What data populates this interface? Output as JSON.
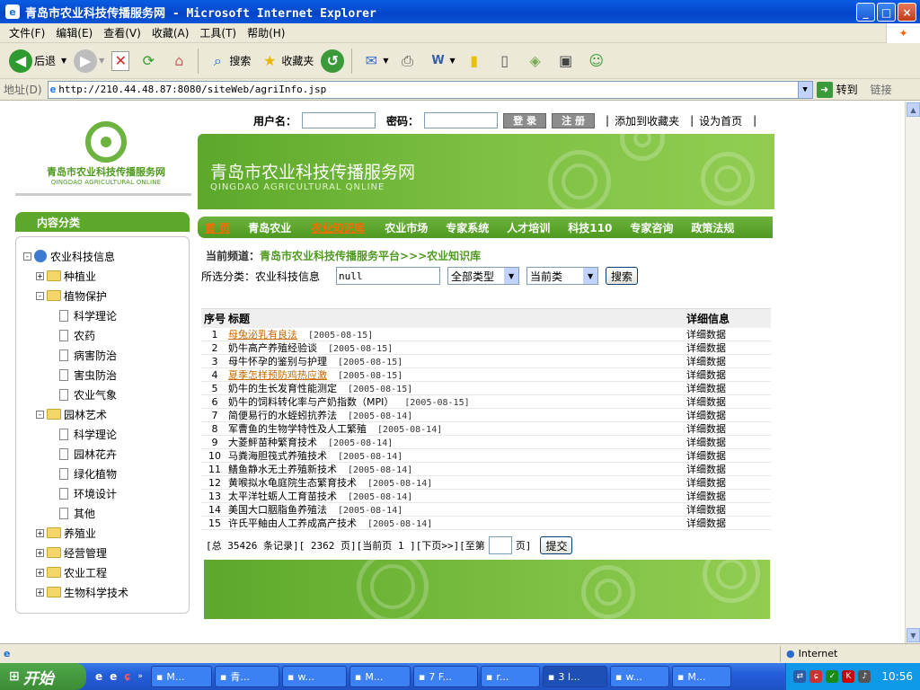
{
  "window": {
    "title": "青岛市农业科技传播服务网 - Microsoft Internet Explorer",
    "minimize_label": "_",
    "maximize_label": "□",
    "close_label": "×"
  },
  "menu": [
    "文件(F)",
    "编辑(E)",
    "查看(V)",
    "收藏(A)",
    "工具(T)",
    "帮助(H)"
  ],
  "toolbar": {
    "back": "后退",
    "search": "搜索",
    "favorites": "收藏夹"
  },
  "address": {
    "label": "地址(D)",
    "url": "http://210.44.48.87:8080/siteWeb/agriInfo.jsp",
    "go": "转到",
    "links": "链接"
  },
  "site": {
    "logo_cn": "青岛市农业科技传播服务网",
    "logo_en": "QINGDAO AGRICULTURAL ONLINE",
    "banner_title": "青岛市农业科技传播服务网",
    "banner_sub": "QINGDAO AGRICULTURAL QNLINE"
  },
  "login": {
    "user_label": "用户名：",
    "pwd_label": "密码：",
    "login_btn": "登 录",
    "register_btn": "注 册",
    "favorites_link": "添加到收藏夹",
    "homepage_link": "设为首页",
    "divider": "|"
  },
  "sidebar": {
    "title": "内容分类",
    "tree": [
      {
        "label": "农业科技信息",
        "level": 0,
        "type": "globe",
        "toggle": "-"
      },
      {
        "label": "种植业",
        "level": 1,
        "type": "folder",
        "toggle": "+"
      },
      {
        "label": "植物保护",
        "level": 1,
        "type": "folder",
        "toggle": "-"
      },
      {
        "label": "科学理论",
        "level": 2,
        "type": "doc"
      },
      {
        "label": "农药",
        "level": 2,
        "type": "doc"
      },
      {
        "label": "病害防治",
        "level": 2,
        "type": "doc"
      },
      {
        "label": "害虫防治",
        "level": 2,
        "type": "doc"
      },
      {
        "label": "农业气象",
        "level": 2,
        "type": "doc"
      },
      {
        "label": "园林艺术",
        "level": 1,
        "type": "folder",
        "toggle": "-"
      },
      {
        "label": "科学理论",
        "level": 2,
        "type": "doc"
      },
      {
        "label": "园林花卉",
        "level": 2,
        "type": "doc"
      },
      {
        "label": "绿化植物",
        "level": 2,
        "type": "doc"
      },
      {
        "label": "环境设计",
        "level": 2,
        "type": "doc"
      },
      {
        "label": "其他",
        "level": 2,
        "type": "doc"
      },
      {
        "label": "养殖业",
        "level": 1,
        "type": "folder",
        "toggle": "+"
      },
      {
        "label": "经营管理",
        "level": 1,
        "type": "folder",
        "toggle": "+"
      },
      {
        "label": "农业工程",
        "level": 1,
        "type": "folder",
        "toggle": "+"
      },
      {
        "label": "生物科学技术",
        "level": 1,
        "type": "folder",
        "toggle": "+"
      }
    ]
  },
  "nav": {
    "items": [
      "首 页",
      "青岛农业",
      "农业知识库",
      "农业市场",
      "专家系统",
      "人才培训",
      "科技110",
      "专家咨询",
      "政策法规"
    ],
    "active": [
      true,
      false,
      true,
      false,
      false,
      false,
      false,
      false,
      false
    ]
  },
  "breadcrumb": {
    "prefix": "当前频道：",
    "path": "青岛市农业科技传播服务平台>>>农业知识库"
  },
  "filter": {
    "label": "所选分类：农业科技信息",
    "query": "null",
    "type": "全部类型",
    "scope": "当前类",
    "search_btn": "搜索"
  },
  "table": {
    "headers": [
      "序号",
      "标题",
      "详细信息"
    ],
    "rows": [
      {
        "no": "1",
        "title": "母兔泌乳有良法",
        "date": "[2005-08-15]",
        "detail": "详细数据",
        "link": true
      },
      {
        "no": "2",
        "title": "奶牛高产养殖经验谈",
        "date": "[2005-08-15]",
        "detail": "详细数据",
        "link": false
      },
      {
        "no": "3",
        "title": "母牛怀孕的鉴别与护理",
        "date": "[2005-08-15]",
        "detail": "详细数据",
        "link": false
      },
      {
        "no": "4",
        "title": "夏季怎样预防鸡热应激",
        "date": "[2005-08-15]",
        "detail": "详细数据",
        "link": true
      },
      {
        "no": "5",
        "title": "奶牛的生长发育性能测定",
        "date": "[2005-08-15]",
        "detail": "详细数据",
        "link": false
      },
      {
        "no": "6",
        "title": "奶牛的饲料转化率与产奶指数（MPI）",
        "date": "[2005-08-15]",
        "detail": "详细数据",
        "link": false
      },
      {
        "no": "7",
        "title": "简便易行的水蛭蚓抗养法",
        "date": "[2005-08-14]",
        "detail": "详细数据",
        "link": false
      },
      {
        "no": "8",
        "title": "军曹鱼的生物学特性及人工繁殖",
        "date": "[2005-08-14]",
        "detail": "详细数据",
        "link": false
      },
      {
        "no": "9",
        "title": "大菱鲆苗种繁育技术",
        "date": "[2005-08-14]",
        "detail": "详细数据",
        "link": false
      },
      {
        "no": "10",
        "title": "马粪海胆筏式养殖技术",
        "date": "[2005-08-14]",
        "detail": "详细数据",
        "link": false
      },
      {
        "no": "11",
        "title": "鳝鱼静水无土养殖新技术",
        "date": "[2005-08-14]",
        "detail": "详细数据",
        "link": false
      },
      {
        "no": "12",
        "title": "黄喉拟水龟庭院生态繁育技术",
        "date": "[2005-08-14]",
        "detail": "详细数据",
        "link": false
      },
      {
        "no": "13",
        "title": "太平洋牡蛎人工育苗技术",
        "date": "[2005-08-14]",
        "detail": "详细数据",
        "link": false
      },
      {
        "no": "14",
        "title": "美国大口胭脂鱼养殖法",
        "date": "[2005-08-14]",
        "detail": "详细数据",
        "link": false
      },
      {
        "no": "15",
        "title": "许氏平鲉由人工养成高产技术",
        "date": "[2005-08-14]",
        "detail": "详细数据",
        "link": false
      }
    ]
  },
  "pager": {
    "summary": "[总 35426 条记录][ 2362 页][当前页 1 ][下页>>][至第",
    "suffix": "页]",
    "submit": "提交"
  },
  "status": {
    "zone": "Internet"
  },
  "taskbar": {
    "start": "开始",
    "buttons": [
      "M...",
      "青...",
      "w...",
      "M...",
      "7 F...",
      "r...",
      "3 I...",
      "w...",
      "M..."
    ],
    "clock": "10:56"
  }
}
